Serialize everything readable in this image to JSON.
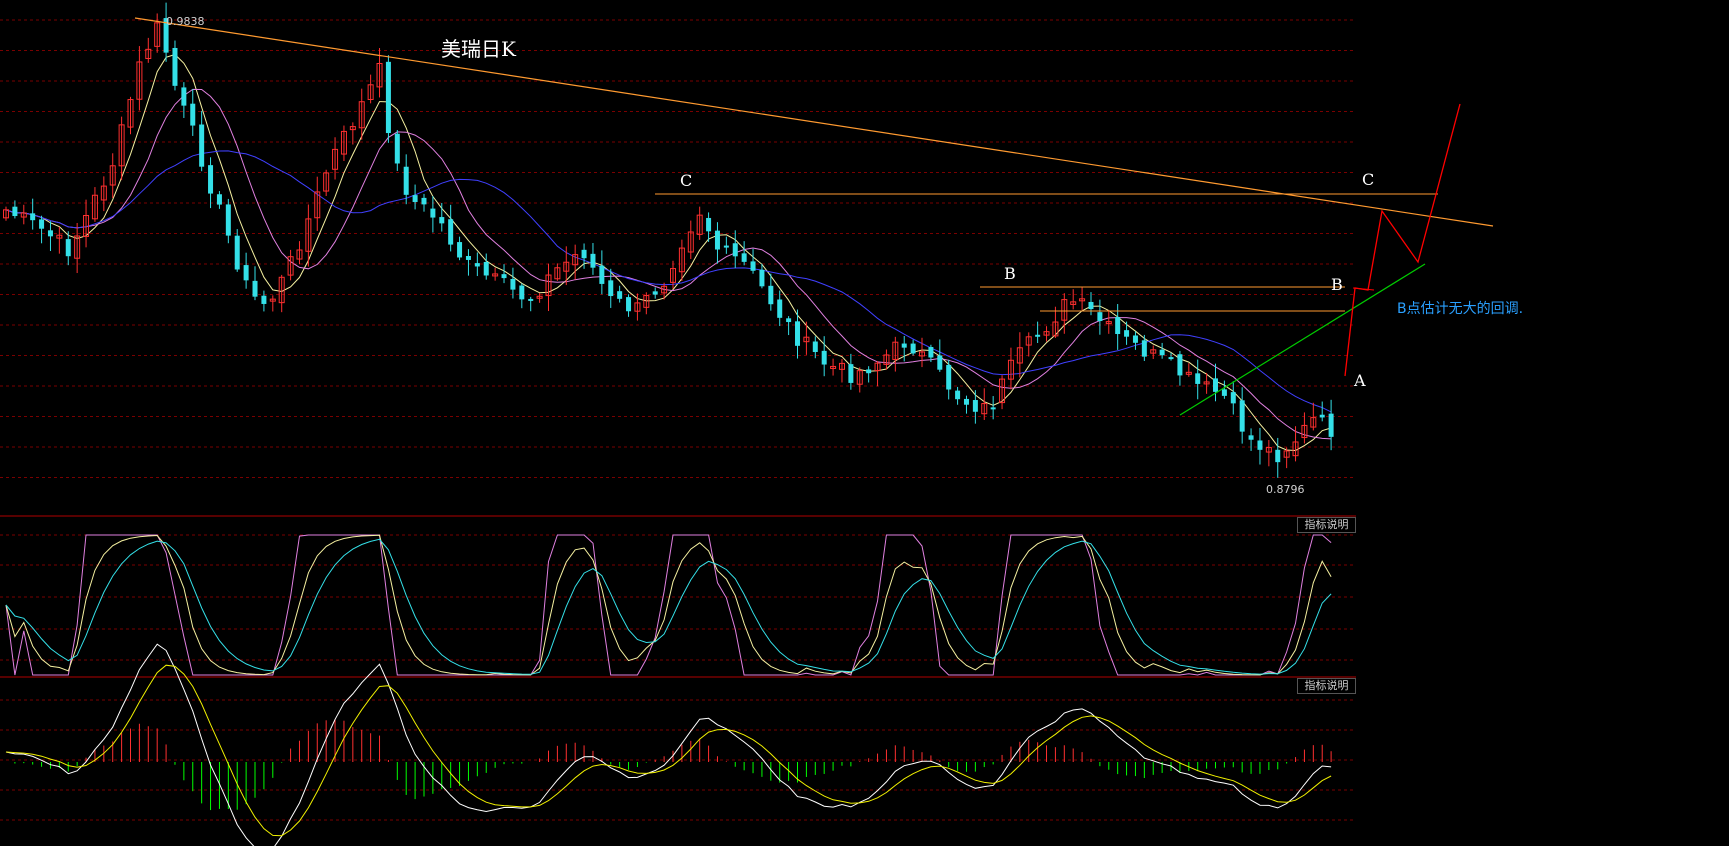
{
  "title": "美瑞日K",
  "annotations": {
    "high_label": "0.9838",
    "low_label": "0.8796",
    "point_c": "C",
    "point_b": "B",
    "point_a": "A",
    "note": "B点估计无大的回调."
  },
  "panels": {
    "kdj_button": "指标说明",
    "macd_button": "指标说明"
  },
  "colors": {
    "up": "#ff3030",
    "down": "#34e0e8",
    "ma_fast": "#f5f0a0",
    "ma_mid": "#e080e0",
    "ma_slow": "#4040ff",
    "trend": "#ff9a30",
    "channel": "#00cc00",
    "forecast": "#ff0000",
    "note": "#2aa0ff",
    "grid": "#7a0000"
  },
  "chart_data": {
    "type": "candlestick",
    "y_high": 0.9838,
    "y_low": 0.8796,
    "candles": 150,
    "series": [
      {
        "name": "K",
        "style": "candlestick"
      }
    ],
    "subpanels": [
      {
        "type": "kdj",
        "lines": 3
      },
      {
        "type": "macd",
        "lines": 2,
        "histogram": true
      }
    ]
  }
}
